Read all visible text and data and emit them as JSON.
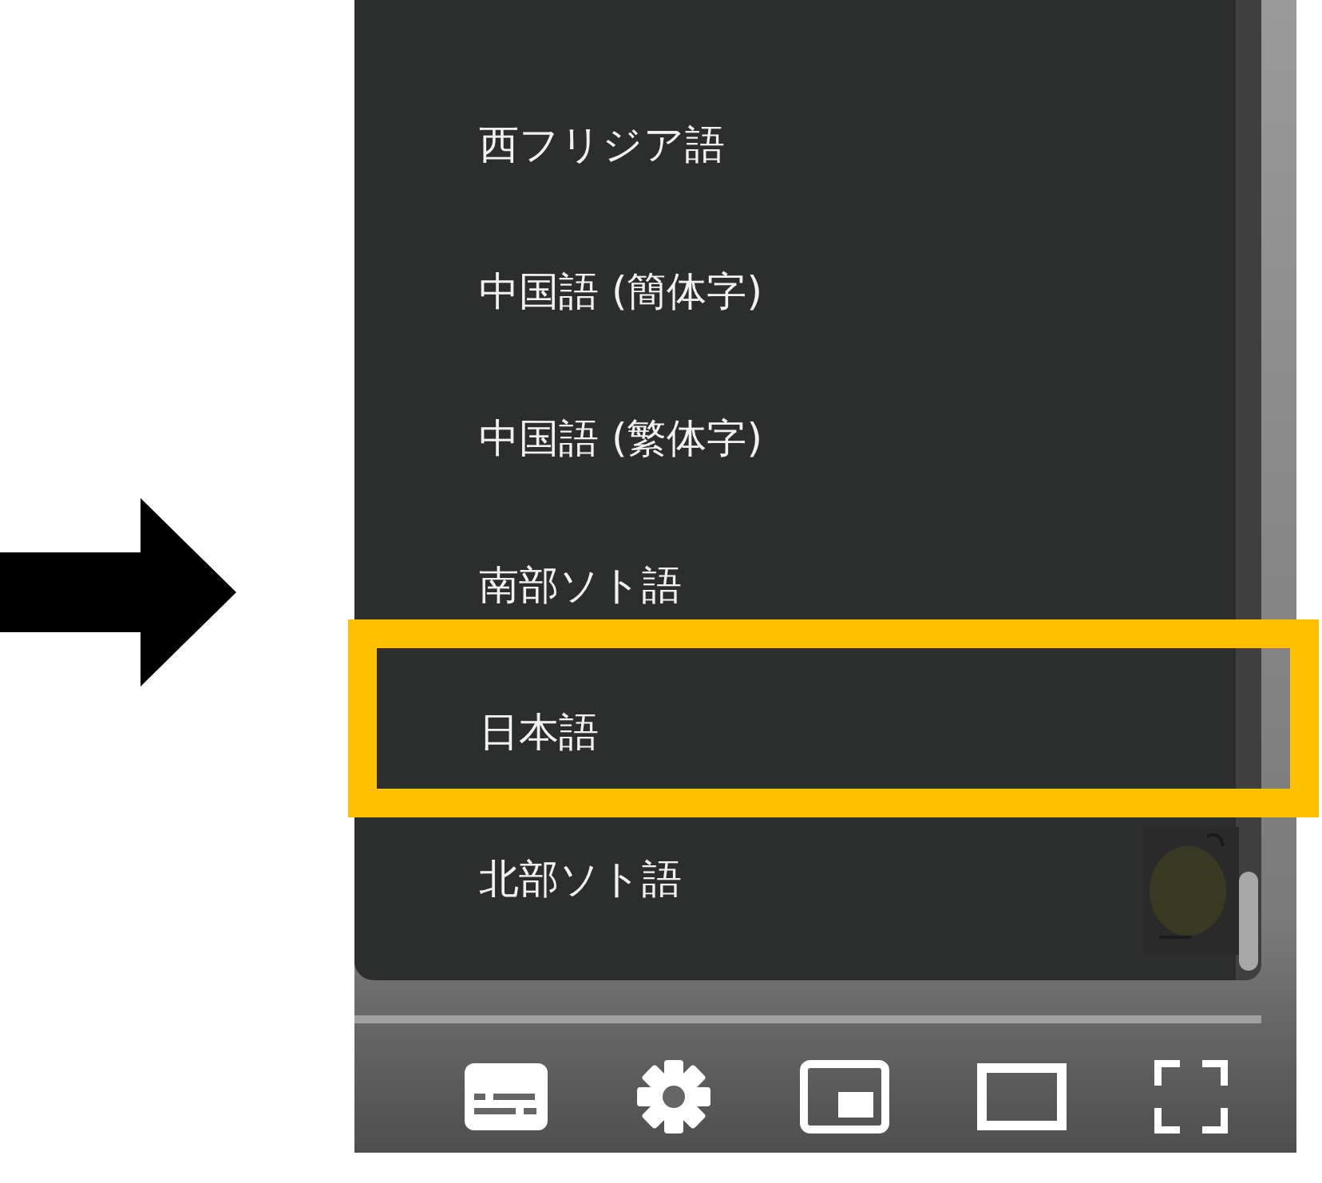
{
  "menu": {
    "items": [
      {
        "label": "西フリジア語",
        "annotated": false
      },
      {
        "label": "中国語 (簡体字)",
        "annotated": false
      },
      {
        "label": "中国語 (繁体字)",
        "annotated": false
      },
      {
        "label": "南部ソト語",
        "annotated": false
      },
      {
        "label": "日本語",
        "annotated": true
      },
      {
        "label": "北部ソト語",
        "annotated": false
      }
    ]
  },
  "controls": [
    {
      "kind": "subtitles"
    },
    {
      "kind": "settings"
    },
    {
      "kind": "miniplayer"
    },
    {
      "kind": "theater"
    },
    {
      "kind": "fullscreen"
    }
  ]
}
